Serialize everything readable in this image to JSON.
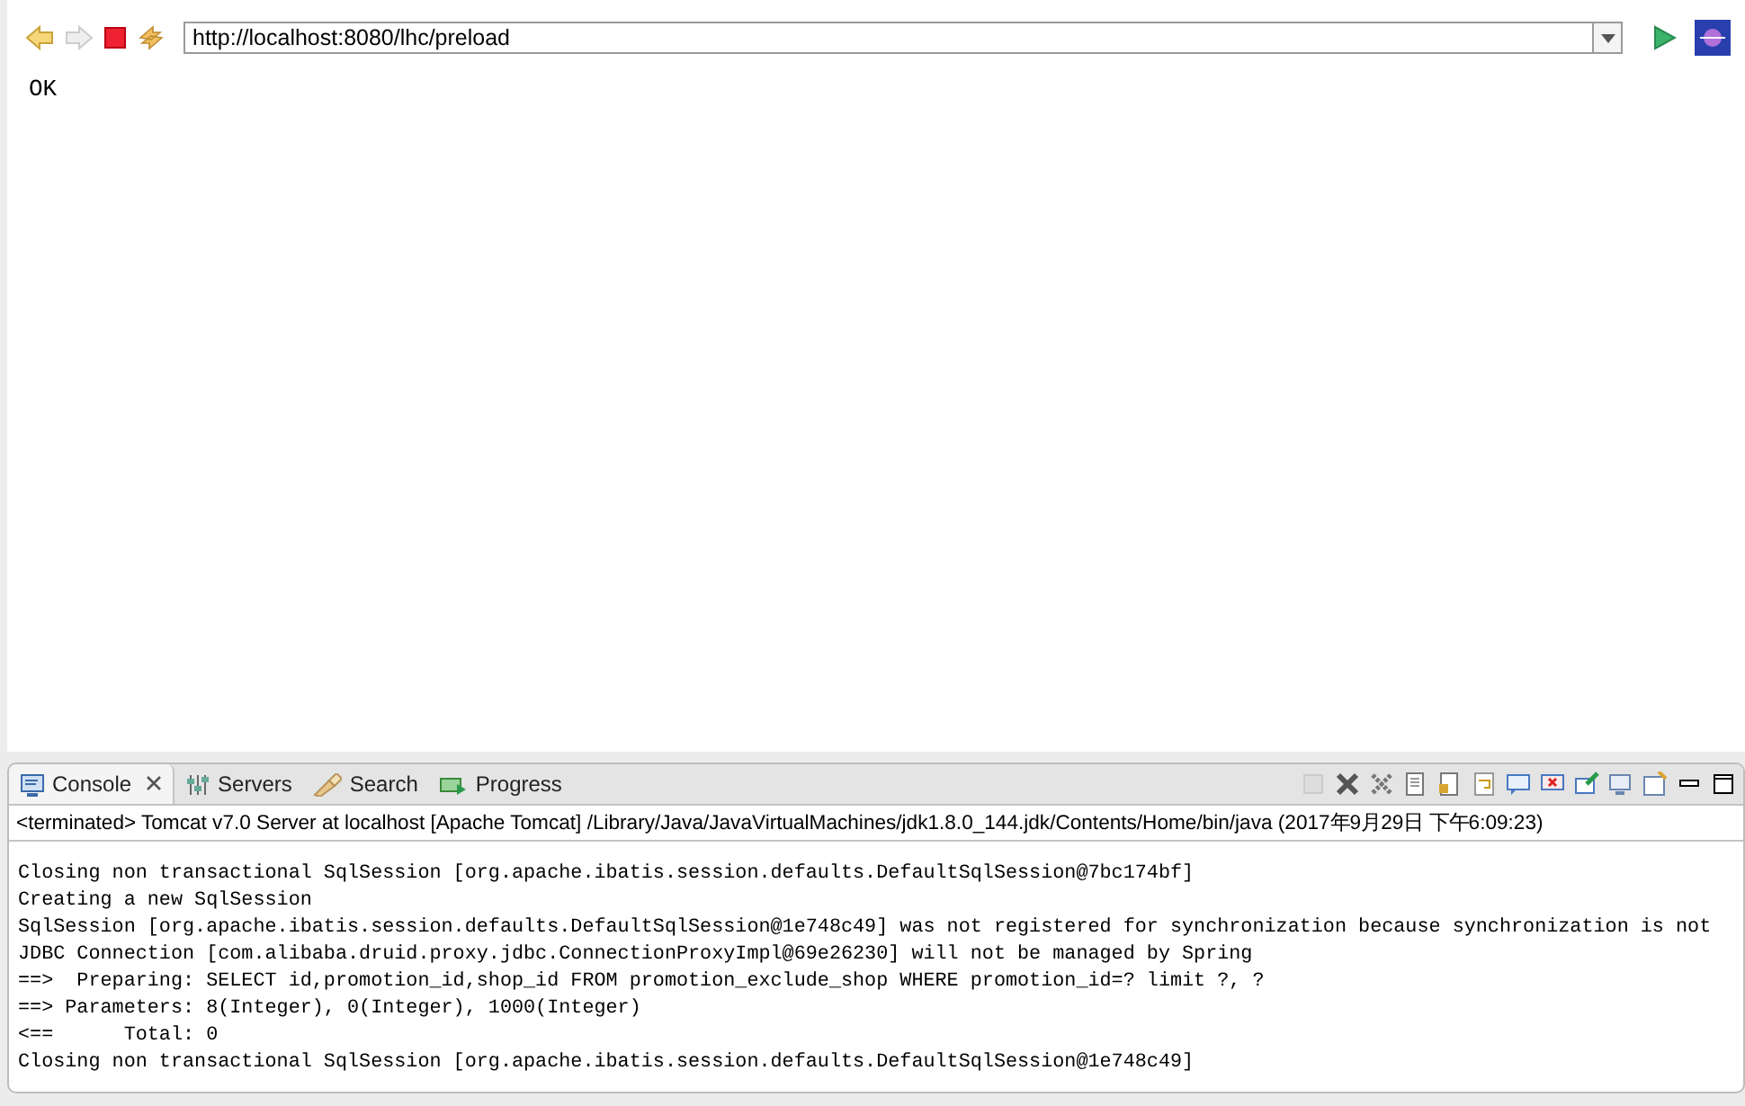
{
  "browser": {
    "url": "http://localhost:8080/lhc/preload",
    "page_text": "OK"
  },
  "console": {
    "tabs": [
      {
        "label": "Console",
        "kind": "console",
        "selected": true,
        "closable": true
      },
      {
        "label": "Servers",
        "kind": "servers",
        "selected": false,
        "closable": false
      },
      {
        "label": "Search",
        "kind": "search",
        "selected": false,
        "closable": false
      },
      {
        "label": "Progress",
        "kind": "progress",
        "selected": false,
        "closable": false
      }
    ],
    "header": "<terminated> Tomcat v7.0 Server at localhost [Apache Tomcat] /Library/Java/JavaVirtualMachines/jdk1.8.0_144.jdk/Contents/Home/bin/java (2017年9月29日 下午6:09:23)",
    "lines": [
      "Closing non transactional SqlSession [org.apache.ibatis.session.defaults.DefaultSqlSession@7bc174bf]",
      "Creating a new SqlSession",
      "SqlSession [org.apache.ibatis.session.defaults.DefaultSqlSession@1e748c49] was not registered for synchronization because synchronization is not",
      "JDBC Connection [com.alibaba.druid.proxy.jdbc.ConnectionProxyImpl@69e26230] will not be managed by Spring",
      "==>  Preparing: SELECT id,promotion_id,shop_id FROM promotion_exclude_shop WHERE promotion_id=? limit ?, ?",
      "==> Parameters: 8(Integer), 0(Integer), 1000(Integer)",
      "<==      Total: 0",
      "Closing non transactional SqlSession [org.apache.ibatis.session.defaults.DefaultSqlSession@1e748c49]"
    ]
  }
}
